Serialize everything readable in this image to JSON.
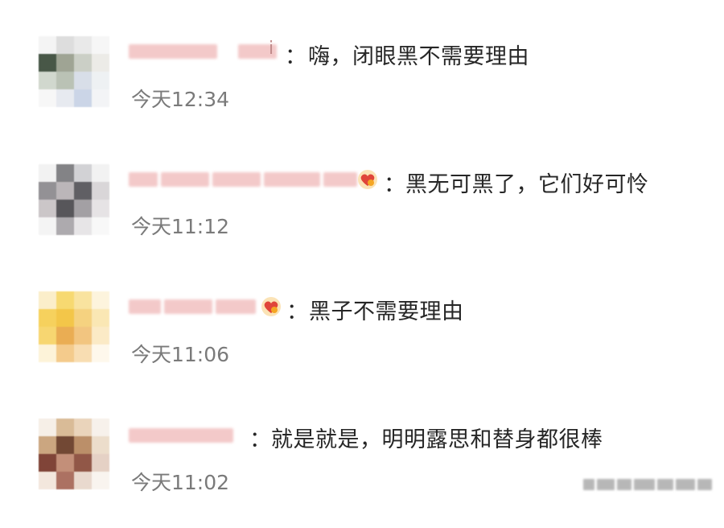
{
  "comments": [
    {
      "separator": "：",
      "text": "嗨，闭眼黑不需要理由",
      "time": "今天12:34",
      "name_tail": "i",
      "has_badge": false
    },
    {
      "separator": "：",
      "text": "黑无可黑了，它们好可怜",
      "time": "今天11:12",
      "has_badge": true,
      "badge_icon": "heart-badge-icon"
    },
    {
      "separator": "：",
      "text": "黑子不需要理由",
      "time": "今天11:06",
      "has_badge": true,
      "badge_icon": "heart-badge-icon"
    },
    {
      "separator": "：",
      "text": "就是就是，明明露思和替身都很棒",
      "time": "今天11:02",
      "has_badge": false
    }
  ],
  "colors": {
    "text": "#262626",
    "time": "#7a7a7a",
    "name_blur": "#f3c9c9",
    "badge": "#f5a623"
  }
}
